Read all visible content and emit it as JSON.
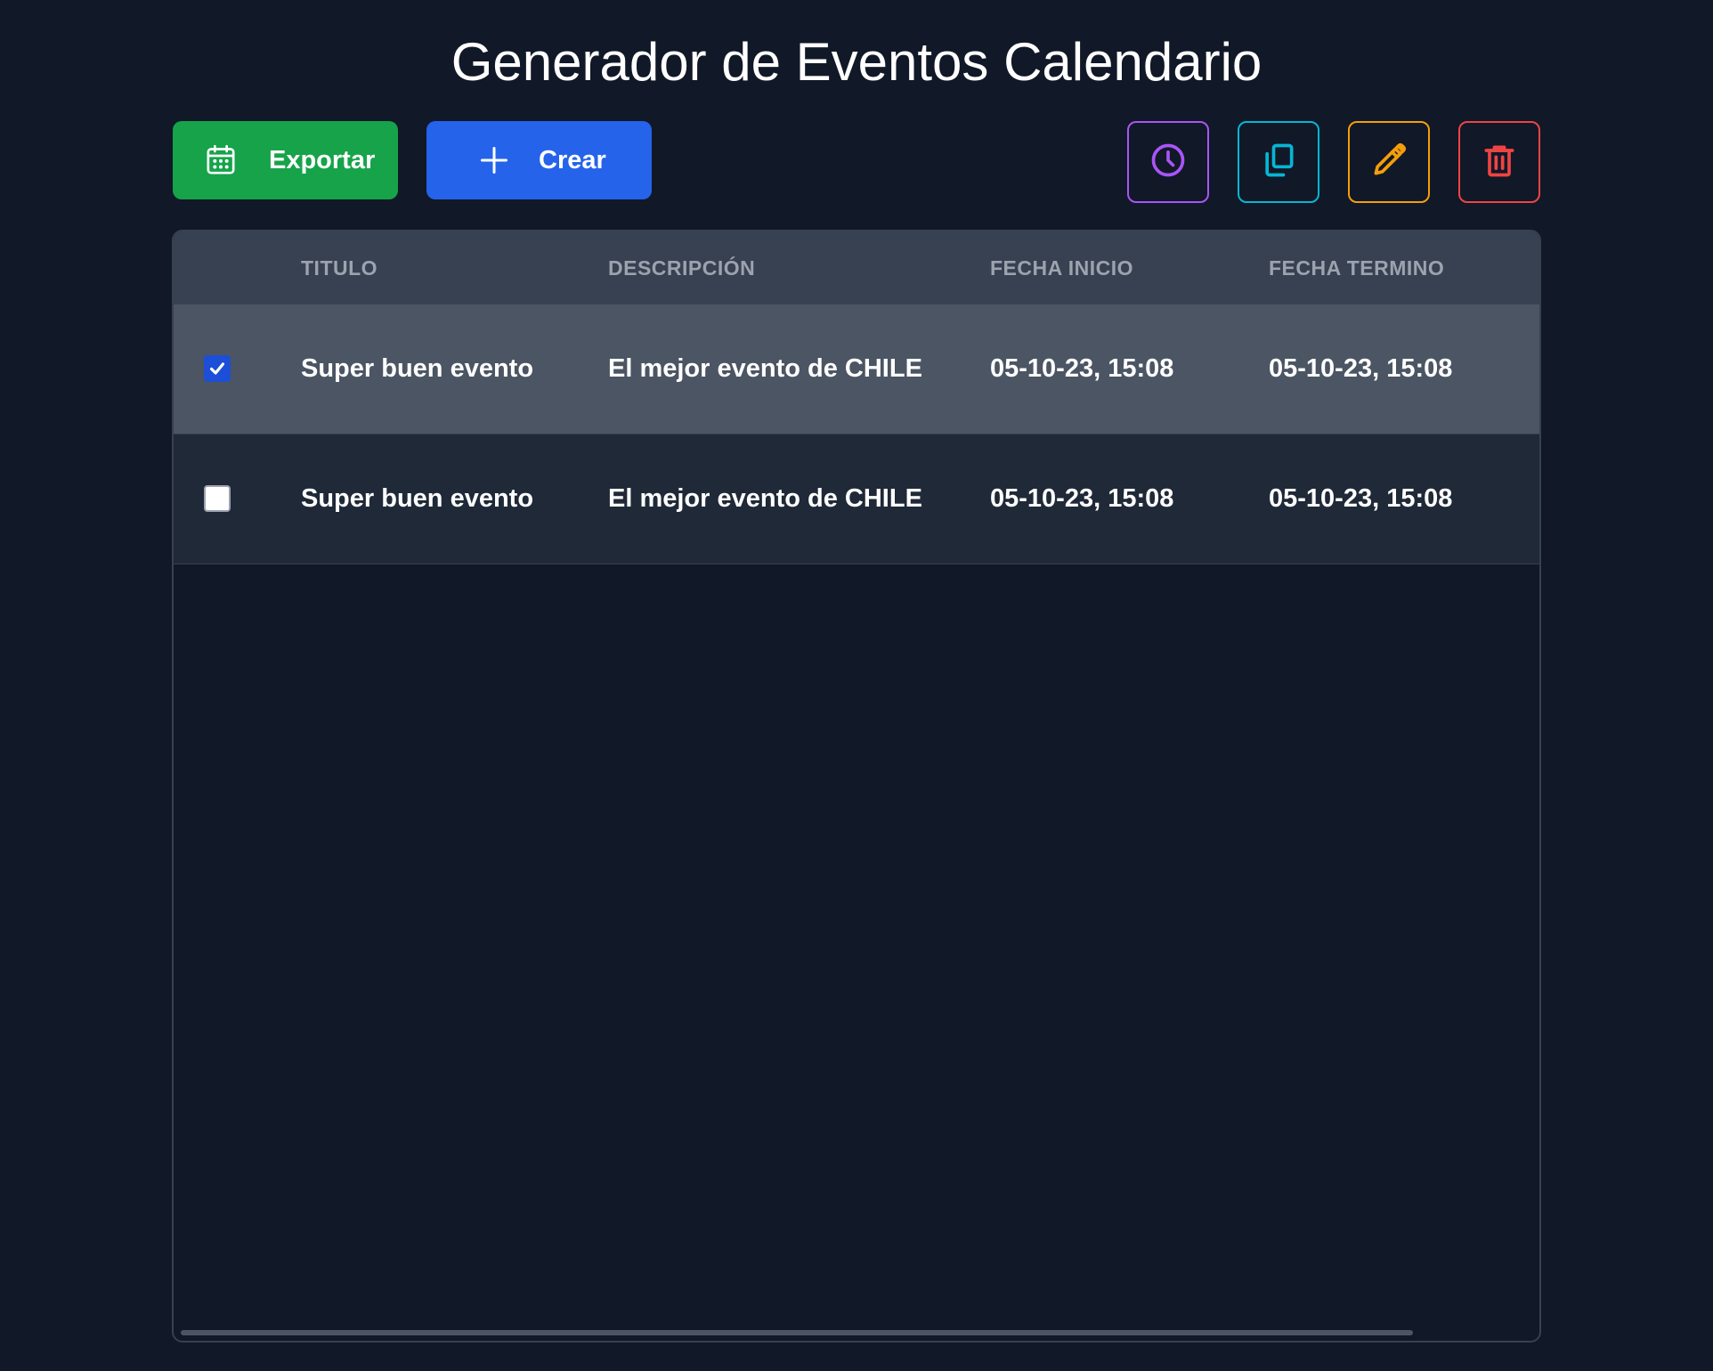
{
  "page": {
    "title": "Generador de Eventos Calendario"
  },
  "toolbar": {
    "export_label": "Exportar",
    "create_label": "Crear",
    "icons": {
      "export": "calendar-icon",
      "create": "plus-icon",
      "history": "clock-icon",
      "copy": "copy-icon",
      "edit": "pencil-icon",
      "delete": "trash-icon"
    }
  },
  "colors": {
    "background": "#111827",
    "export_button": "#16a34a",
    "create_button": "#2563eb",
    "history_button": "#a855f7",
    "copy_button": "#06b6d4",
    "edit_button": "#f59e0b",
    "delete_button": "#ef4444",
    "header_row": "#374151",
    "selected_row": "#4b5563",
    "row": "#1f2937"
  },
  "table": {
    "columns": [
      "TITULO",
      "DESCRIPCIÓN",
      "FECHA INICIO",
      "FECHA TERMINO"
    ],
    "rows": [
      {
        "selected": true,
        "titulo": "Super buen evento",
        "descripcion": "El mejor evento de CHILE",
        "fecha_inicio": "05-10-23, 15:08",
        "fecha_termino": "05-10-23, 15:08"
      },
      {
        "selected": false,
        "titulo": "Super buen evento",
        "descripcion": "El mejor evento de CHILE",
        "fecha_inicio": "05-10-23, 15:08",
        "fecha_termino": "05-10-23, 15:08"
      }
    ]
  }
}
